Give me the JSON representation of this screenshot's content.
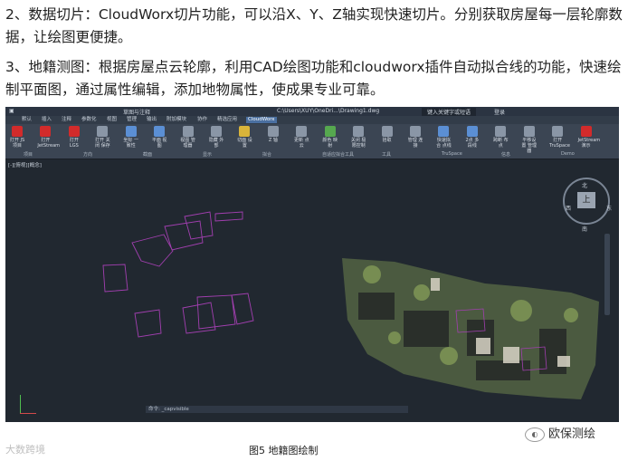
{
  "article": {
    "p1": "2、数据切片：CloudWorx切片功能，可以沿X、Y、Z轴实现快速切片。分别获取房屋每一层轮廓数据，让绘图更便捷。",
    "p2": "3、地籍测图：根据房屋点云轮廓，利用CAD绘图功能和cloudworx插件自动拟合线的功能，快速绘制平面图，通过属性编辑，添加地物属性，使成果专业可靠。"
  },
  "cad": {
    "title_left": "草图与注释",
    "title_path": "C:\\Users\\XUY\\OneDri...\\Drawing1.dwg",
    "title_search": "键入关键字或短语",
    "title_user": "登录",
    "tabs": [
      "默认",
      "插入",
      "注释",
      "参数化",
      "视图",
      "管理",
      "输出",
      "附加模块",
      "协作",
      "精选应用",
      "CloudWorx"
    ],
    "active_tab": "CloudWorx",
    "ribbon_buttons": [
      {
        "label": "打开 JS项目",
        "icon": "red"
      },
      {
        "label": "打开 JetStream",
        "icon": "red"
      },
      {
        "label": "打开 LGS",
        "icon": "red"
      },
      {
        "label": "打开 关闭 保存",
        "icon": "gray"
      },
      {
        "label": "坐标 一致性",
        "icon": "blue"
      },
      {
        "label": "平面 视图",
        "icon": "blue"
      },
      {
        "label": "视图 管理器",
        "icon": "gray"
      },
      {
        "label": "隐藏 外部",
        "icon": "gray"
      },
      {
        "label": "切面 设置",
        "icon": "yellow"
      },
      {
        "label": "Z 轴",
        "icon": "gray"
      },
      {
        "label": "更新 点云",
        "icon": "gray"
      },
      {
        "label": "颜色 映射",
        "icon": "green"
      },
      {
        "label": "关闭 极限控制",
        "icon": "gray"
      },
      {
        "label": "拾取",
        "icon": "gray"
      },
      {
        "label": "管理 连接",
        "icon": "gray"
      },
      {
        "label": "快速拟合 点线",
        "icon": "blue"
      },
      {
        "label": "2点 多段线",
        "icon": "blue"
      },
      {
        "label": "跨断 布点",
        "icon": "gray"
      },
      {
        "label": "平移设置 管理器",
        "icon": "gray"
      },
      {
        "label": "打开 TruSpace",
        "icon": "gray"
      },
      {
        "label": "JetStream 演示",
        "icon": "red"
      }
    ],
    "ribbon_groups": [
      "项目",
      "方向",
      "截面",
      "显示",
      "拟合",
      "自适应拟合工具",
      "工具",
      "TruSpace",
      "信息",
      "Demo"
    ],
    "viewport_label": "[-][俯视][概念]",
    "navcube": {
      "top": "上",
      "north": "北",
      "south": "南",
      "west": "西",
      "east": "东"
    },
    "command_line": "命令: _capvisible"
  },
  "caption": "图5  地籍图绘制",
  "watermark_left": "大数跨境",
  "watermark_right": "欧保测绘",
  "colors": {
    "outline": "#a23fb0",
    "background": "#212830"
  }
}
